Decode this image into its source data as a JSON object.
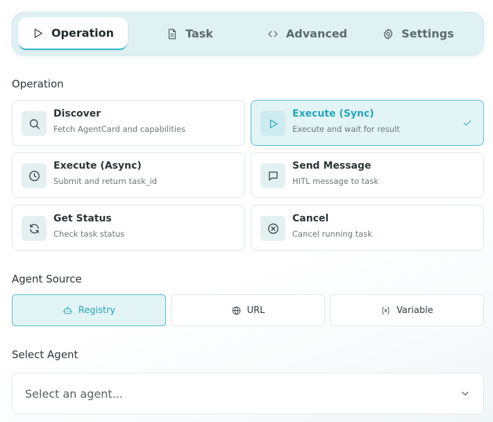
{
  "tabs": [
    {
      "label": "Operation",
      "icon": "play-icon",
      "active": true
    },
    {
      "label": "Task",
      "icon": "document-icon",
      "active": false
    },
    {
      "label": "Advanced",
      "icon": "code-icon",
      "active": false
    },
    {
      "label": "Settings",
      "icon": "gear-icon",
      "active": false
    }
  ],
  "operation": {
    "label": "Operation",
    "options": [
      {
        "title": "Discover",
        "desc": "Fetch AgentCard and capabilities",
        "icon": "search-icon",
        "selected": false
      },
      {
        "title": "Execute (Sync)",
        "desc": "Execute and wait for result",
        "icon": "play-icon",
        "selected": true
      },
      {
        "title": "Execute (Async)",
        "desc": "Submit and return task_id",
        "icon": "clock-icon",
        "selected": false
      },
      {
        "title": "Send Message",
        "desc": "HITL message to task",
        "icon": "message-icon",
        "selected": false
      },
      {
        "title": "Get Status",
        "desc": "Check task status",
        "icon": "refresh-icon",
        "selected": false
      },
      {
        "title": "Cancel",
        "desc": "Cancel running task",
        "icon": "cancel-circle-icon",
        "selected": false
      }
    ]
  },
  "agent_source": {
    "label": "Agent Source",
    "options": [
      {
        "label": "Registry",
        "icon": "bot-icon",
        "selected": true
      },
      {
        "label": "URL",
        "icon": "globe-icon",
        "selected": false
      },
      {
        "label": "Variable",
        "icon": "variable-icon",
        "selected": false
      }
    ]
  },
  "select_agent": {
    "label": "Select Agent",
    "placeholder": "Select an agent..."
  },
  "colors": {
    "accent": "#23a5ba",
    "selected_bg": "#e3f4f6",
    "tab_bar_bg": "#dff1f3"
  }
}
